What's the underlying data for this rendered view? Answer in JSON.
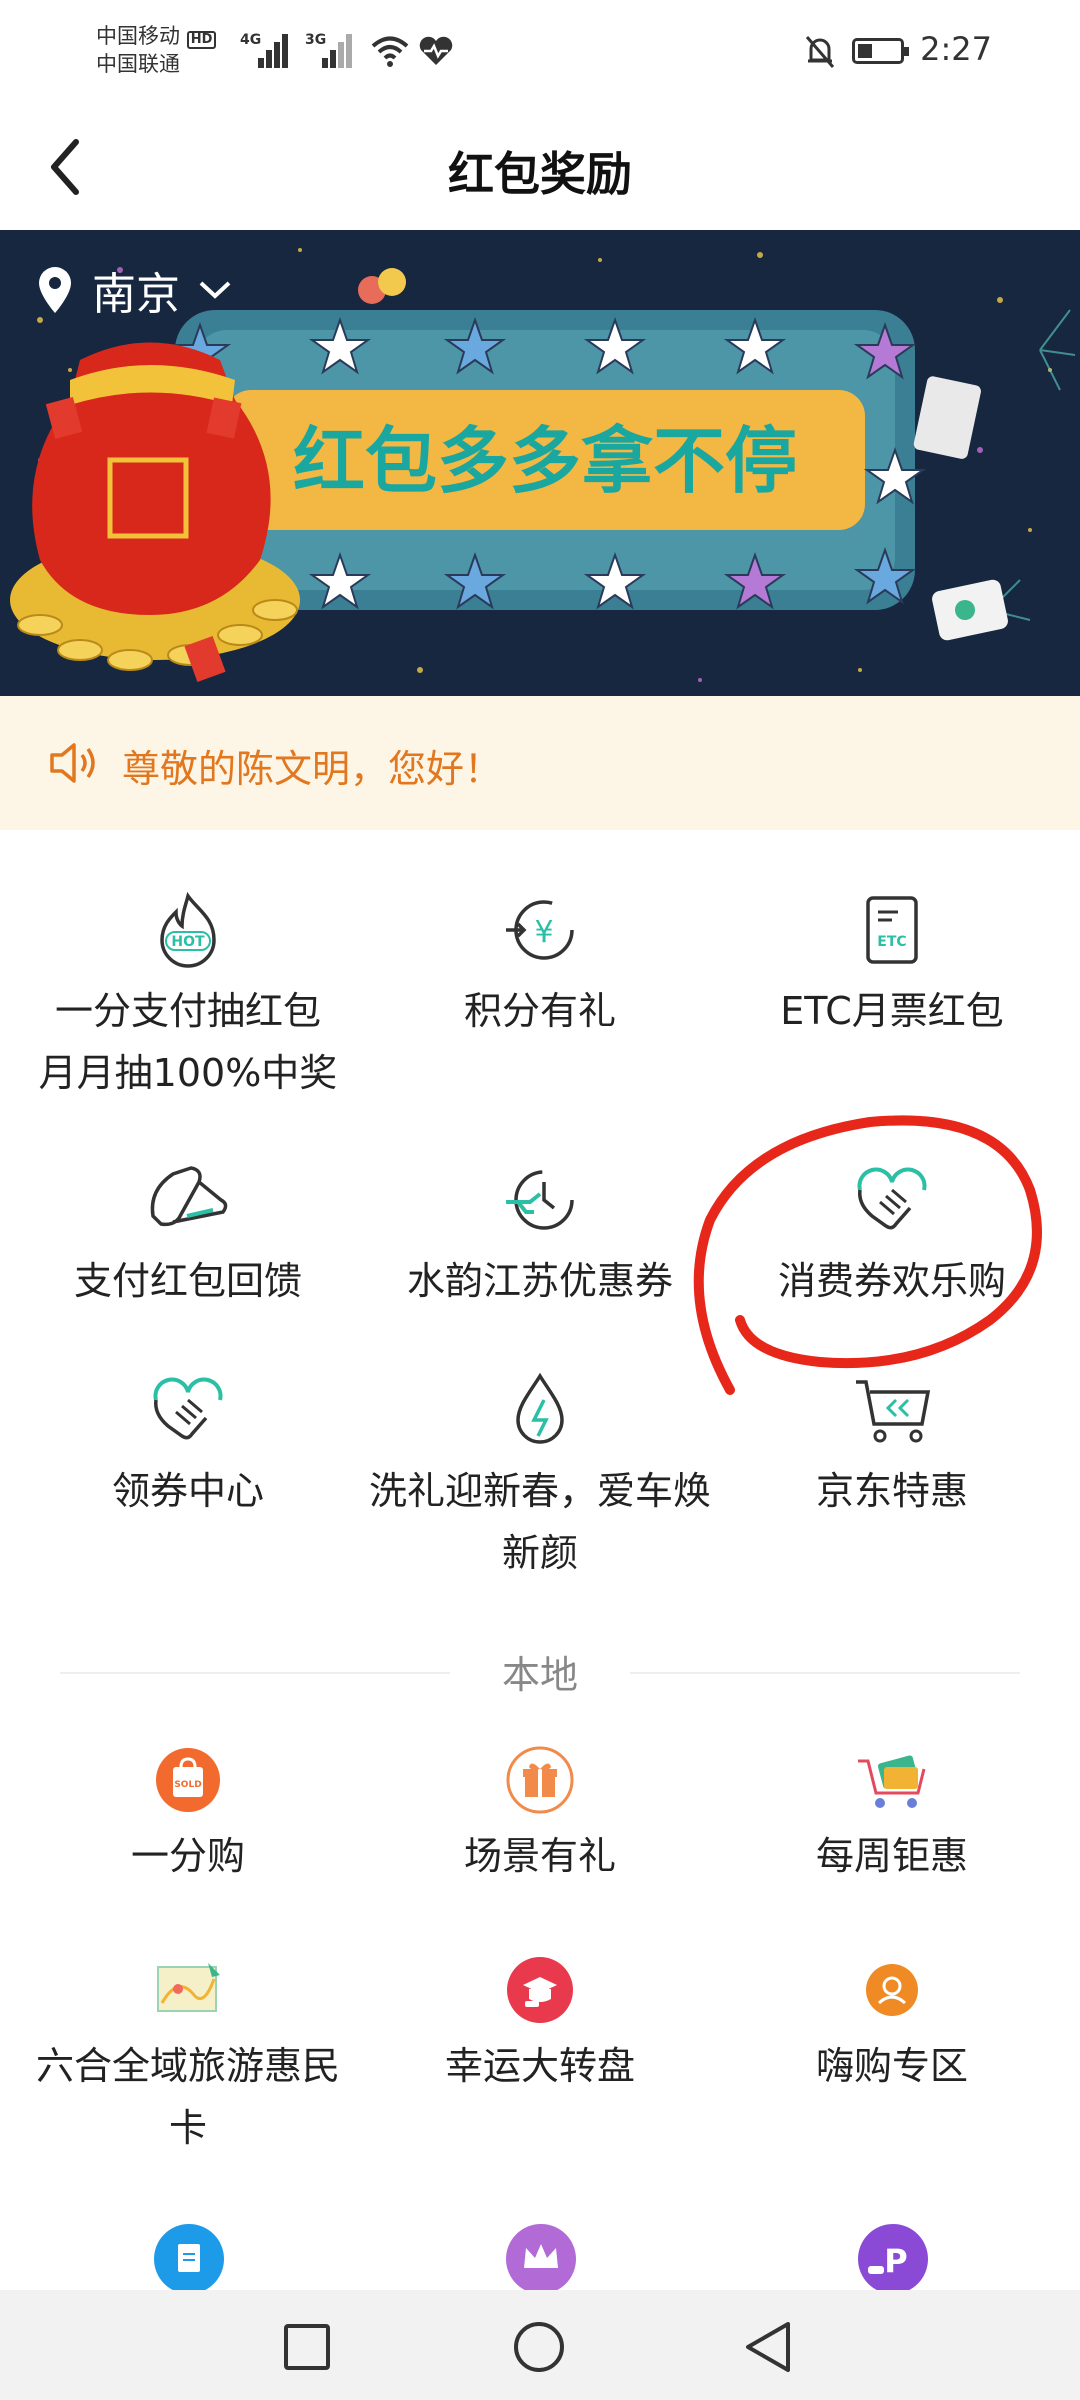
{
  "status": {
    "carrier_1": "中国移动",
    "carrier_2": "中国联通",
    "hd": "HD",
    "net_1": "4G",
    "net_2": "3G",
    "time": "2:27"
  },
  "header": {
    "title": "红包奖励"
  },
  "banner": {
    "city": "南京",
    "slogan": "红包多多拿不停"
  },
  "notice": {
    "text": "尊敬的陈文明，您好！"
  },
  "grid": [
    {
      "label": "一分支付抽红包\n月月抽100%中奖",
      "icon": "hot-flame-icon",
      "icon_text": "HOT"
    },
    {
      "label": "积分有礼",
      "icon": "points-yuan-icon"
    },
    {
      "label": "ETC月票红包",
      "icon": "etc-card-icon",
      "icon_text": "ETC"
    },
    {
      "label": "支付红包回馈",
      "icon": "coupon-pay-icon"
    },
    {
      "label": "水韵江苏优惠券",
      "icon": "travel-plane-icon"
    },
    {
      "label": "消费券欢乐购",
      "icon": "handshake-icon"
    },
    {
      "label": "领券中心",
      "icon": "handshake-coupon-icon"
    },
    {
      "label": "洗礼迎新春，爱车焕新颜",
      "icon": "water-drop-icon"
    },
    {
      "label": "京东特惠",
      "icon": "cart-icon"
    }
  ],
  "section": {
    "local_label": "本地"
  },
  "local": [
    {
      "label": "一分购",
      "icon": "sold-bag-icon",
      "icon_text": "SOLD"
    },
    {
      "label": "场景有礼",
      "icon": "gift-icon"
    },
    {
      "label": "每周钜惠",
      "icon": "shopping-cart-card-icon"
    },
    {
      "label": "六合全域旅游惠民卡",
      "icon": "travel-map-icon"
    },
    {
      "label": "幸运大转盘",
      "icon": "lucky-wheel-icon"
    },
    {
      "label": "嗨购专区",
      "icon": "shopping-user-icon"
    }
  ],
  "colors": {
    "accent_teal": "#2bbfa5",
    "notice_orange": "#e1771e",
    "annotation_red": "#e8271b"
  }
}
